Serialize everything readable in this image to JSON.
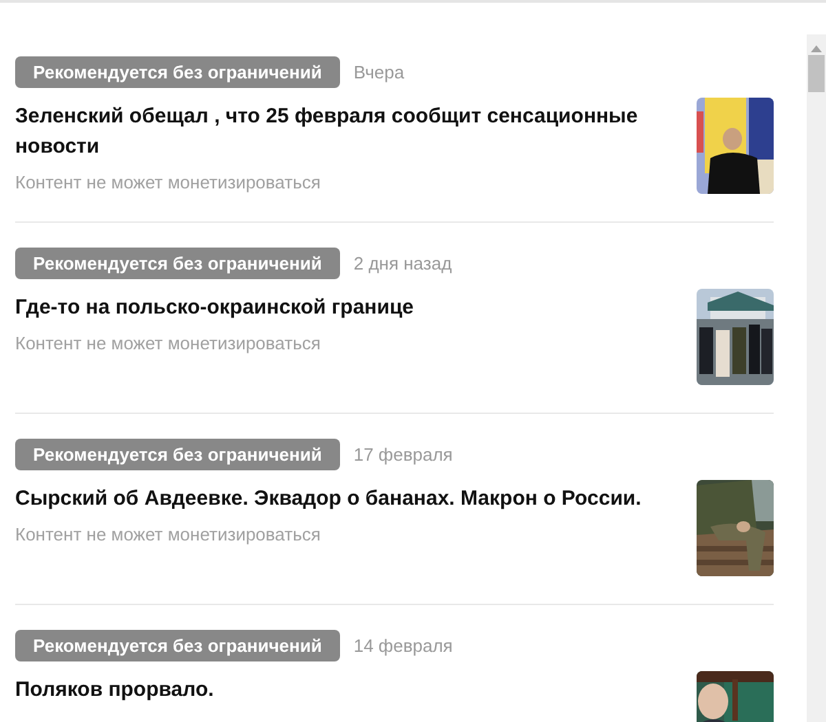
{
  "items": [
    {
      "badge": "Рекомендуется без ограничений",
      "date": "Вчера",
      "title": "Зеленский обещал , что 25 февраля сообщит сенсационные новости",
      "note": "Контент не может монетизироваться"
    },
    {
      "badge": "Рекомендуется без ограничений",
      "date": "2 дня назад",
      "title": "Где-то на польско-окраинской границе",
      "note": "Контент не может монетизироваться"
    },
    {
      "badge": "Рекомендуется без ограничений",
      "date": "17 февраля",
      "title": "Сырский об Авдеевке. Эквадор о бананах. Макрон о России.",
      "note": "Контент не может монетизироваться"
    },
    {
      "badge": "Рекомендуется без ограничений",
      "date": "14 февраля",
      "title": "Поляков прорвало."
    }
  ]
}
